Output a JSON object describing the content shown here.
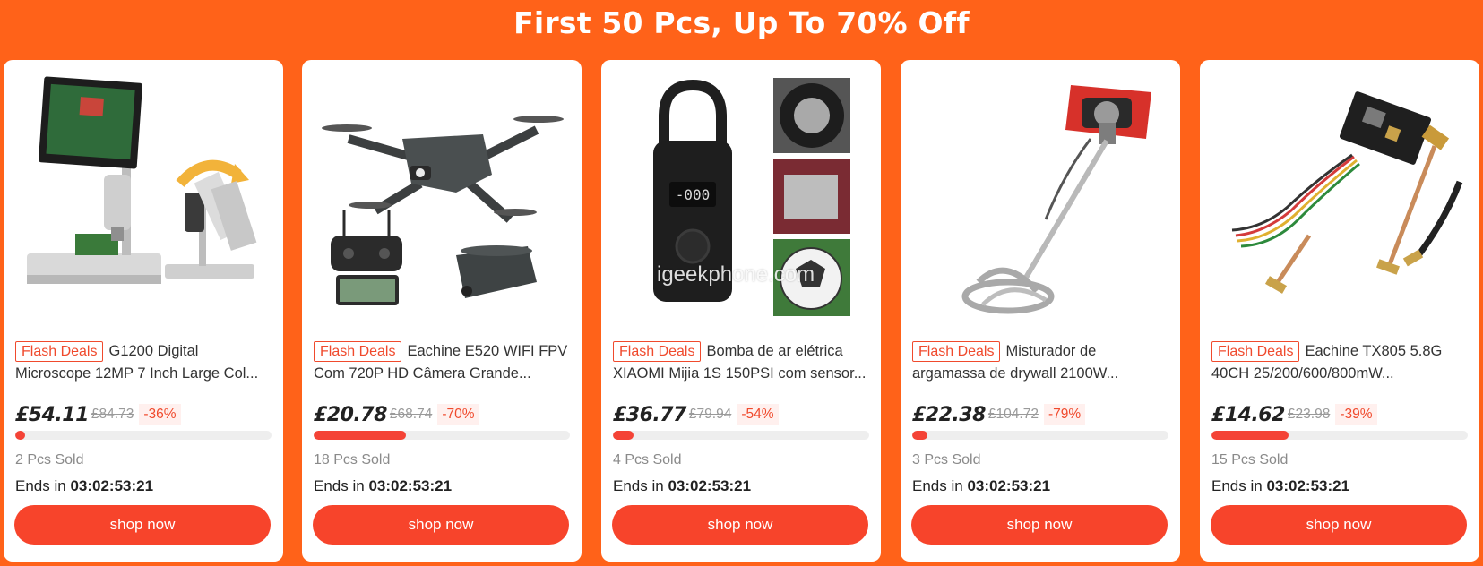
{
  "banner": {
    "title": "First 50 Pcs, Up To 70% Off"
  },
  "watermark": "igeekphone.com",
  "products": [
    {
      "badge": "Flash Deals",
      "title_line1": "G1200 Digital",
      "title_line2": "Microscope 12MP 7 Inch Large Col...",
      "price": "£54.11",
      "old_price": "£84.73",
      "discount": "-36%",
      "sold_fraction": 0.04,
      "sold": "2 Pcs Sold",
      "ends_label": "Ends in",
      "ends_time": "03:02:53:21",
      "button": "shop now"
    },
    {
      "badge": "Flash Deals",
      "title_line1": "Eachine E520 WIFI FPV",
      "title_line2": "Com 720P HD Câmera Grande...",
      "price": "£20.78",
      "old_price": "£68.74",
      "discount": "-70%",
      "sold_fraction": 0.36,
      "sold": "18 Pcs Sold",
      "ends_label": "Ends in",
      "ends_time": "03:02:53:21",
      "button": "shop now"
    },
    {
      "badge": "Flash Deals",
      "title_line1": "Bomba de ar elétrica",
      "title_line2": "XIAOMI Mijia 1S 150PSI com sensor...",
      "price": "£36.77",
      "old_price": "£79.94",
      "discount": "-54%",
      "sold_fraction": 0.08,
      "sold": "4 Pcs Sold",
      "ends_label": "Ends in",
      "ends_time": "03:02:53:21",
      "button": "shop now"
    },
    {
      "badge": "Flash Deals",
      "title_line1": "Misturador de",
      "title_line2": "argamassa de drywall 2100W...",
      "price": "£22.38",
      "old_price": "£104.72",
      "discount": "-79%",
      "sold_fraction": 0.06,
      "sold": "3 Pcs Sold",
      "ends_label": "Ends in",
      "ends_time": "03:02:53:21",
      "button": "shop now"
    },
    {
      "badge": "Flash Deals",
      "title_line1": "Eachine TX805 5.8G",
      "title_line2": "40CH 25/200/600/800mW...",
      "price": "£14.62",
      "old_price": "£23.98",
      "discount": "-39%",
      "sold_fraction": 0.3,
      "sold": "15 Pcs Sold",
      "ends_label": "Ends in",
      "ends_time": "03:02:53:21",
      "button": "shop now"
    }
  ],
  "colors": {
    "background": "#ff6219",
    "accent": "#f7442b",
    "badge": "#f04a2d",
    "progress_track": "#eeeeee"
  }
}
